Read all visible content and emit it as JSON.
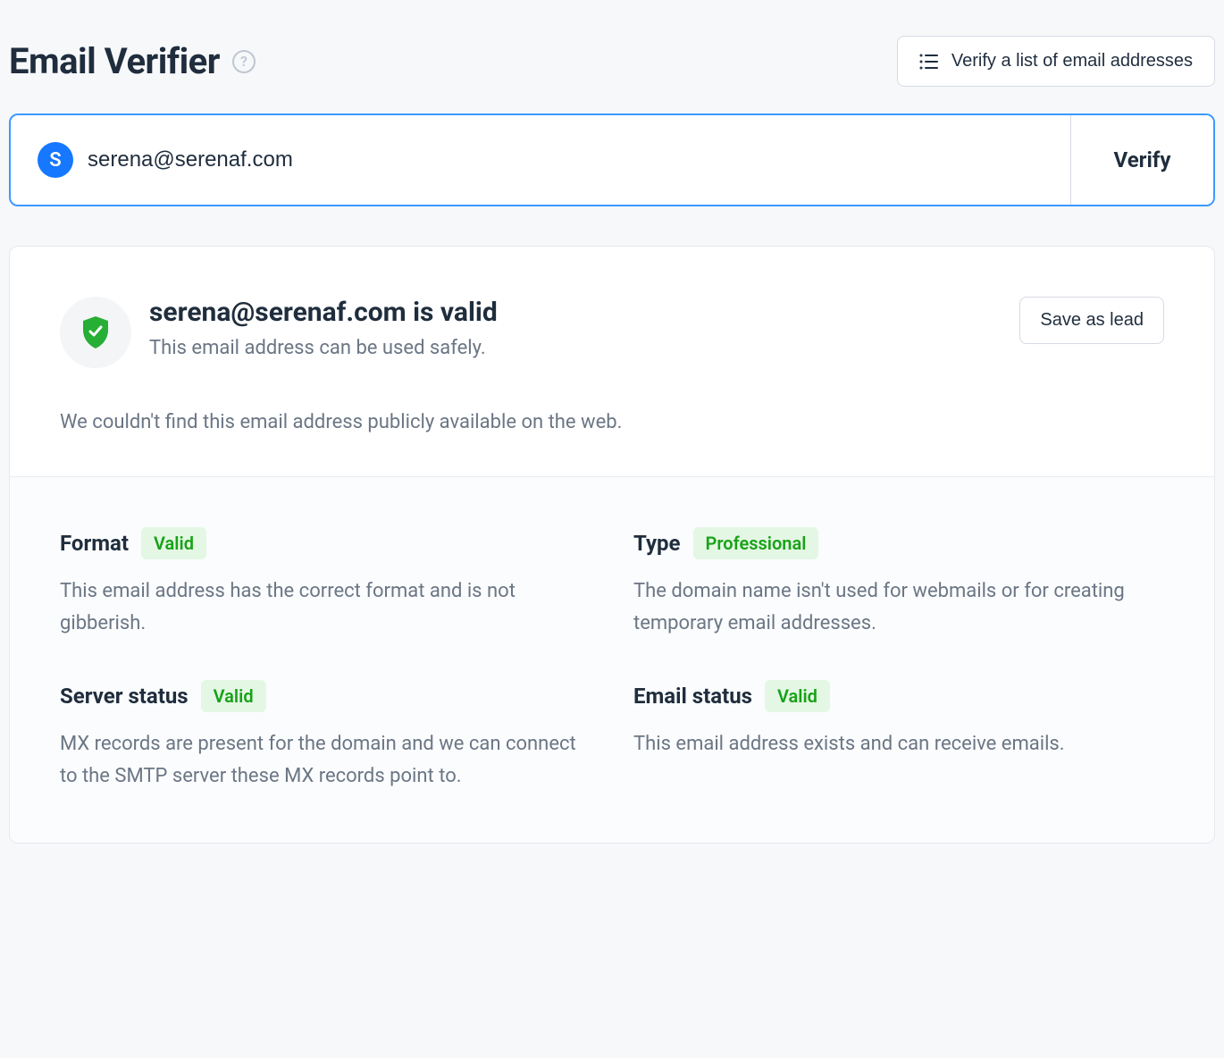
{
  "header": {
    "title": "Email Verifier",
    "help_symbol": "?",
    "verify_list_label": "Verify a list of email addresses"
  },
  "search": {
    "avatar_letter": "S",
    "email_value": "serena@serenaf.com",
    "verify_label": "Verify"
  },
  "result": {
    "heading": "serena@serenaf.com is valid",
    "subheading": "This email address can be used safely.",
    "save_lead_label": "Save as lead",
    "notfound_text": "We couldn't find this email address publicly available on the web."
  },
  "details": {
    "format": {
      "title": "Format",
      "badge": "Valid",
      "desc": "This email address has the correct format and is not gibberish."
    },
    "type": {
      "title": "Type",
      "badge": "Professional",
      "desc": "The domain name isn't used for webmails or for creating temporary email addresses."
    },
    "server_status": {
      "title": "Server status",
      "badge": "Valid",
      "desc": "MX records are present for the domain and we can connect to the SMTP server these MX records point to."
    },
    "email_status": {
      "title": "Email status",
      "badge": "Valid",
      "desc": "This email address exists and can receive emails."
    }
  },
  "colors": {
    "accent": "#3b99ff",
    "avatar_bg": "#1677ff",
    "badge_bg": "#e4f7e4",
    "badge_fg": "#18a218",
    "shield_fg": "#27ae35"
  }
}
